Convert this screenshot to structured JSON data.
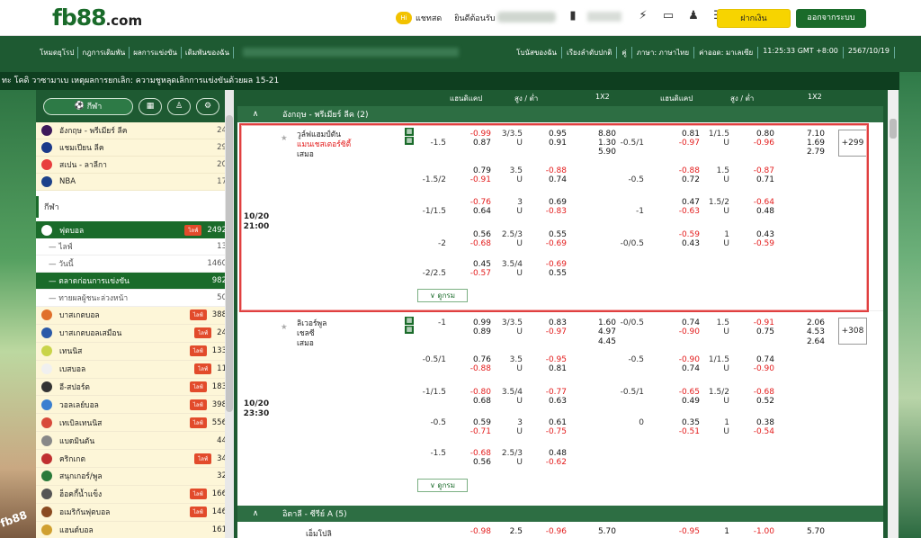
{
  "brand": {
    "name": "fb88",
    "suffix": ".com",
    "side_label": "fb88"
  },
  "top": {
    "chat": "แชทสด",
    "welcome": "ยินดีต้อนรับ",
    "deposit": "ฝากเงิน",
    "logout": "ออกจากระบบ",
    "icons": [
      "wallet-icon",
      "usd-icon",
      "transfer-icon",
      "ticket-icon",
      "user-icon",
      "list-icon"
    ]
  },
  "nav": {
    "items": [
      "โหมดยุโรป",
      "กฎการเดิมพัน",
      "ผลการแข่งขัน",
      "เดิมพันของฉัน"
    ],
    "right": [
      "โบนัสของฉัน",
      "เรียงลำดับปกติ",
      "คู่",
      "ภาษา: ภาษาไทย",
      "ค่าออด: มาเลเซีย",
      "11:25:33 GMT +8:00",
      "2567/10/19"
    ]
  },
  "marquee": "ทะ โคดิ วาซามาเบ เหตุผลการยกเลิก: ความชูหลุดเลิกการแข่งขันด้วยผล 15-21",
  "sidebar": {
    "sport_tab": "กีฬา",
    "fav": [
      {
        "label": "อังกฤษ - พรีเมียร์ ลีค",
        "count": "24",
        "color": "#3d195b"
      },
      {
        "label": "แชมเปียน ลีค",
        "count": "29",
        "color": "#1b3a8a"
      },
      {
        "label": "สเปน - ลาลีกา",
        "count": "20",
        "color": "#e83e3e"
      },
      {
        "label": "NBA",
        "count": "17",
        "color": "#1d428a"
      }
    ],
    "section": "กีฬา",
    "football": {
      "label": "ฟุตบอล",
      "count": "2492",
      "live": "ไลฟ์"
    },
    "subs": [
      {
        "label": "ไลฟ์",
        "count": "13",
        "active": false
      },
      {
        "label": "วันนี้",
        "count": "1460",
        "active": false
      },
      {
        "label": "ตลาดก่อนการแข่งขัน",
        "count": "982",
        "active": true
      },
      {
        "label": "ทายผลผู้ชนะล่วงหน้า",
        "count": "50",
        "active": false
      }
    ],
    "sports": [
      {
        "label": "บาสเกตบอล",
        "count": "388",
        "live": true,
        "color": "#e0702a"
      },
      {
        "label": "บาสเกตบอลเสมือน",
        "count": "24",
        "live": true,
        "color": "#2b5aa8"
      },
      {
        "label": "เทนนิส",
        "count": "133",
        "live": true,
        "color": "#c9d44a"
      },
      {
        "label": "เบสบอล",
        "count": "11",
        "live": true,
        "color": "#f0f0f0"
      },
      {
        "label": "อี-สปอร์ต",
        "count": "183",
        "live": true,
        "color": "#333333"
      },
      {
        "label": "วอลเลย์บอล",
        "count": "398",
        "live": true,
        "color": "#3a7fd0"
      },
      {
        "label": "เทเบิลเทนนิส",
        "count": "556",
        "live": true,
        "color": "#d84a3a"
      },
      {
        "label": "แบดมินตัน",
        "count": "44",
        "live": false,
        "color": "#888888"
      },
      {
        "label": "คริกเกต",
        "count": "34",
        "live": true,
        "color": "#c03030"
      },
      {
        "label": "สนุกเกอร์/พูล",
        "count": "32",
        "live": false,
        "color": "#2a7a3a"
      },
      {
        "label": "ฮ็อคกี้น้ำแข็ง",
        "count": "166",
        "live": true,
        "color": "#555555"
      },
      {
        "label": "อเมริกันฟุตบอล",
        "count": "146",
        "live": true,
        "color": "#8a4a20"
      },
      {
        "label": "แฮนด์บอล",
        "count": "161",
        "live": false,
        "color": "#d0a030"
      }
    ]
  },
  "table": {
    "headers": [
      "แฮนดิแคป",
      "สูง / ต่ำ",
      "1X2",
      "แฮนดิแคป",
      "สูง / ต่ำ",
      "1X2"
    ],
    "leagues": [
      "อังกฤษ - พรีเมียร์ ลีค (2)",
      "อิตาลี - ซีรีย์ A (5)"
    ],
    "more": "ดูกรม",
    "matches": [
      {
        "date": "10/20",
        "time": "21:00",
        "home": "วูล์ฟแฮมป์ตัน",
        "away": "แมนเชสเตอร์ซิตี้",
        "draw": "เสมอ",
        "plus": "+299"
      },
      {
        "date": "10/20",
        "time": "23:30",
        "home": "ลิเวอร์พูล",
        "away": "เชลซี",
        "draw": "เสมอ",
        "plus": "+308"
      }
    ],
    "m1": [
      [
        "",
        "-0.99",
        "3/3.5",
        "0.95",
        "8.80",
        "",
        "0.81",
        "1/1.5",
        "0.80",
        "7.10"
      ],
      [
        "-1.5",
        "0.87",
        "U",
        "0.91",
        "1.30",
        "-0.5/1",
        "-0.97",
        "U",
        "-0.96",
        "1.69"
      ],
      [
        "",
        "",
        "",
        "",
        "5.90",
        "",
        "",
        "",
        "",
        "2.79"
      ],
      [
        "",
        "0.79",
        "3.5",
        "-0.88",
        "",
        "",
        "-0.88",
        "1.5",
        "-0.87",
        ""
      ],
      [
        "-1.5/2",
        "-0.91",
        "U",
        "0.74",
        "",
        "-0.5",
        "0.72",
        "U",
        "0.71",
        ""
      ],
      [
        "",
        "-0.76",
        "3",
        "0.69",
        "",
        "",
        "0.47",
        "1.5/2",
        "-0.64",
        ""
      ],
      [
        "-1/1.5",
        "0.64",
        "U",
        "-0.83",
        "",
        "-1",
        "-0.63",
        "U",
        "0.48",
        ""
      ],
      [
        "",
        "0.56",
        "2.5/3",
        "0.55",
        "",
        "",
        "-0.59",
        "1",
        "0.43",
        ""
      ],
      [
        "-2",
        "-0.68",
        "U",
        "-0.69",
        "",
        "-0/0.5",
        "0.43",
        "U",
        "-0.59",
        ""
      ],
      [
        "",
        "0.45",
        "3.5/4",
        "-0.69",
        "",
        "",
        "",
        "",
        "",
        ""
      ],
      [
        "-2/2.5",
        "-0.57",
        "U",
        "0.55",
        "",
        "",
        "",
        "",
        "",
        ""
      ]
    ],
    "m2": [
      [
        "-1",
        "0.99",
        "3/3.5",
        "0.83",
        "1.60",
        "-0/0.5",
        "0.74",
        "1.5",
        "-0.91",
        "2.06"
      ],
      [
        "",
        "0.89",
        "U",
        "-0.97",
        "4.97",
        "",
        "-0.90",
        "U",
        "0.75",
        "4.53"
      ],
      [
        "",
        "",
        "",
        "",
        "4.45",
        "",
        "",
        "",
        "",
        "2.64"
      ],
      [
        "-0.5/1",
        "0.76",
        "3.5",
        "-0.95",
        "",
        "-0.5",
        "-0.90",
        "1/1.5",
        "0.74",
        ""
      ],
      [
        "",
        "-0.88",
        "U",
        "0.81",
        "",
        "",
        "0.74",
        "U",
        "-0.90",
        ""
      ],
      [
        "-1/1.5",
        "-0.80",
        "3.5/4",
        "-0.77",
        "",
        "-0.5/1",
        "-0.65",
        "1.5/2",
        "-0.68",
        ""
      ],
      [
        "",
        "0.68",
        "U",
        "0.63",
        "",
        "",
        "0.49",
        "U",
        "0.52",
        ""
      ],
      [
        "-0.5",
        "0.59",
        "3",
        "0.61",
        "",
        "0",
        "0.35",
        "1",
        "0.38",
        ""
      ],
      [
        "",
        "-0.71",
        "U",
        "-0.75",
        "",
        "",
        "-0.51",
        "U",
        "-0.54",
        ""
      ],
      [
        "-1.5",
        "-0.68",
        "2.5/3",
        "0.48",
        "",
        "",
        "",
        "",
        "",
        ""
      ],
      [
        "",
        "0.56",
        "U",
        "-0.62",
        "",
        "",
        "",
        "",
        "",
        ""
      ]
    ],
    "m3": {
      "home": "เอ็มโปลิ",
      "row": [
        "",
        "-0.98",
        "2.5",
        "-0.96",
        "5.70",
        "",
        "-0.95",
        "1",
        "-1.00",
        "5.70"
      ]
    }
  }
}
